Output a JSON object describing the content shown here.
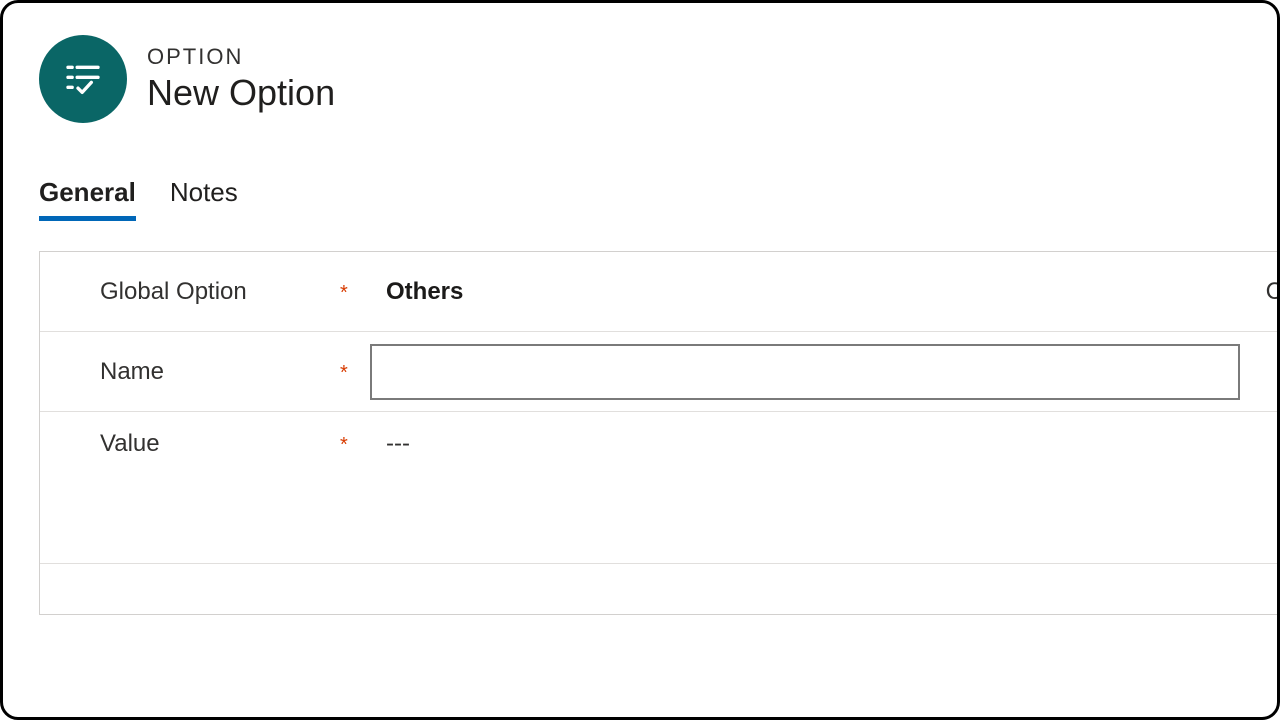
{
  "header": {
    "type_label": "OPTION",
    "title": "New Option"
  },
  "tabs": [
    {
      "label": "General",
      "active": true
    },
    {
      "label": "Notes",
      "active": false
    }
  ],
  "fields": {
    "global_option": {
      "label": "Global Option",
      "required_marker": "*",
      "value": "Others",
      "right_char": "C"
    },
    "name": {
      "label": "Name",
      "required_marker": "*",
      "value": ""
    },
    "value": {
      "label": "Value",
      "required_marker": "*",
      "placeholder": "---"
    }
  }
}
